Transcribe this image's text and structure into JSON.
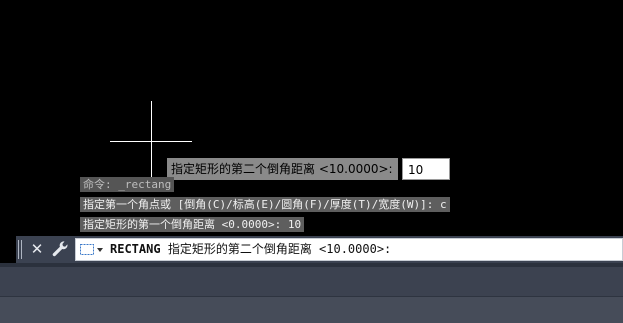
{
  "drawing": {
    "dynamic_input": {
      "prompt": "指定矩形的第二个倒角距离 <10.0000>:",
      "value": "10"
    }
  },
  "history": [
    "命令: _rectang",
    "指定第一个角点或 [倒角(C)/标高(E)/圆角(F)/厚度(T)/宽度(W)]: c",
    "指定矩形的第一个倒角距离 <0.0000>: 10"
  ],
  "command_line": {
    "command": "RECTANG",
    "prompt": "指定矩形的第二个倒角距离 <10.0000>:",
    "close_glyph": "✕"
  },
  "colors": {
    "canvas": "#000000",
    "command_bar": "#3b4251",
    "history_bg": "#5e5e5e",
    "dynamic_prompt_bg": "#8a8a8a"
  },
  "icons": [
    "close-icon",
    "wrench-icon",
    "recent-commands-icon",
    "chevron-down-icon"
  ]
}
